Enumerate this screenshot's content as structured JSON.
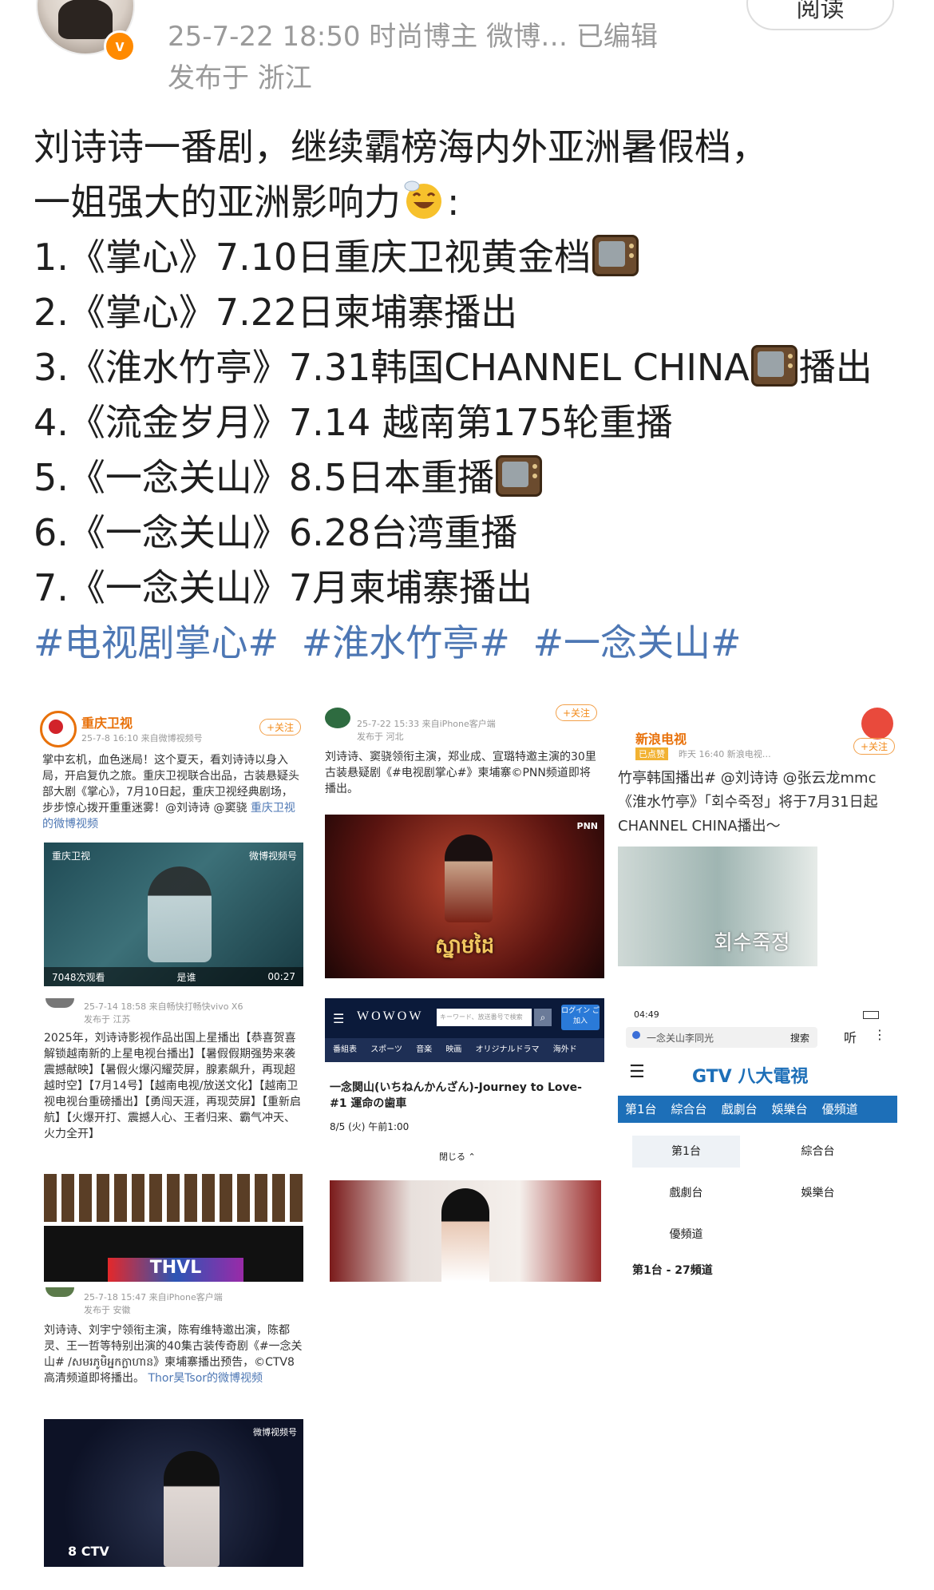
{
  "header": {
    "meta_line": "25-7-22 18:50  时尚博主 微博…  已编辑",
    "location_line": "发布于 浙江",
    "read_button": "阅读",
    "verified_badge": "v"
  },
  "post": {
    "lines": [
      "刘诗诗一番剧，继续霸榜海内外亚洲暑假档，",
      "一姐强大的亚洲影响力",
      "1.《掌心》7.10日重庆卫视黄金档",
      "2.《掌心》7.22日柬埔寨播出",
      "3.《淮水竹亭》7.31韩国CHANNEL CHINA",
      "播出",
      "4.《流金岁月》7.14 越南第175轮重播",
      "5.《一念关山》8.5日本重播",
      "6.《一念关山》6.28台湾重播",
      "7.《一念关山》7月柬埔寨播出"
    ],
    "colon": ":",
    "hashtags": [
      "#电视剧掌心#",
      "#淮水竹亭#",
      "#一念关山#"
    ]
  },
  "tiles": {
    "t1": {
      "account": "重庆卫视",
      "follow": "+关注",
      "time": "25-7-8 16:10 来自微博视频号",
      "text": "掌中玄机，血色迷局！这个夏天，看刘诗诗以身入局，开启复仇之旅。重庆卫视联合出品，古装悬疑头部大剧《掌心》，7月10日起，重庆卫视经典剧场，步步惊心拨开重重迷雾！@刘诗诗 @窦骁",
      "link": "重庆卫视的微博视频",
      "channel_logo": "重庆卫视",
      "watermark": "微博视频号",
      "views": "7048次观看",
      "duration": "00:27",
      "caption": "是谁"
    },
    "t2": {
      "time": "25-7-22 15:33 来自iPhone客户端",
      "location": "发布于 河北",
      "follow": "+关注",
      "text": "刘诗诗、窦骁领衔主演，郑业成、宣璐特邀主演的30里古装悬疑剧《#电视剧掌心#》柬埔寨©PNN频道即将播出。",
      "poster_title": "PNN",
      "poster_caption": "ស្នាមដៃ"
    },
    "t3": {
      "account": "新浪电视",
      "follow": "+关注",
      "tag": "已点赞",
      "time": "昨天 16:40 新浪电视…",
      "line1": "竹亭韩国播出# @刘诗诗 @张云龙mmc",
      "line2": "《淮水竹亭》「회수죽정」将于7月31日起",
      "line3": "CHANNEL CHINA播出～",
      "poster_text": "회수죽정"
    },
    "t4": {
      "time": "25-7-14 18:58 来自畅快打畅快vivo X6",
      "location": "发布于 江苏",
      "text": "2025年，刘诗诗影视作品出国上星播出【恭喜贺喜解锁越南新的上星电视台播出】【暑假假期强势来袭震撼献映】【暑假火爆闪耀荧屏，腺素飙升，再现超越时空】【7月14号】【越南电视/放送文化】【越南卫视电视台重磅播出】【勇闯天涯，再现荧屏】【重新启航】【火爆开打、震撼人心、王者归来、霸气冲天、火力全开】",
      "logo_text": "THVL"
    },
    "t5": {
      "brand": "WOWOW",
      "search_placeholder": "キーワード、放送番号で検索",
      "login": "ログイン ご加入",
      "nav": [
        "番組表",
        "スポーツ",
        "音楽",
        "映画",
        "オリジナルドラマ",
        "海外ド"
      ],
      "title": "一念関山(いちねんかんざん)-Journey to Love- #1 運命の歯車",
      "airtime": "8/5 (火) 午前1:00",
      "close": "閉じる"
    },
    "t6": {
      "status_time": "04:49",
      "search_text": "一念关山李同光",
      "search_button": "搜索",
      "listen": "听",
      "brand": "GTV 八大電視",
      "tabs": [
        "第1台",
        "綜合台",
        "戲劇台",
        "娛樂台",
        "優頻道"
      ],
      "grid": [
        "第1台",
        "綜合台",
        "戲劇台",
        "娛樂台",
        "優頻道"
      ],
      "footer": "第1台 - 27頻道"
    },
    "t7": {
      "time": "25-7-18 15:47 来自iPhone客户端",
      "location": "发布于 安徽",
      "text": "刘诗诗、刘宇宁领衔主演，陈宥维特邀出演，陈都灵、王一哲等特别出演的40集古装传奇剧《#一念关山# /សមរភូមិអ្នកក្លាហាន》柬埔寨播出预告，©CTV8高清频道即将播出。",
      "link": "Thor昊Tsor的微博视频",
      "watermark": "微博视频号",
      "channel": "8 CTV"
    }
  },
  "colors": {
    "hashtag": "#4d77b4",
    "meta": "#9a9a9a",
    "orange": "#e8710a",
    "gtv_blue": "#1d6fb8"
  }
}
